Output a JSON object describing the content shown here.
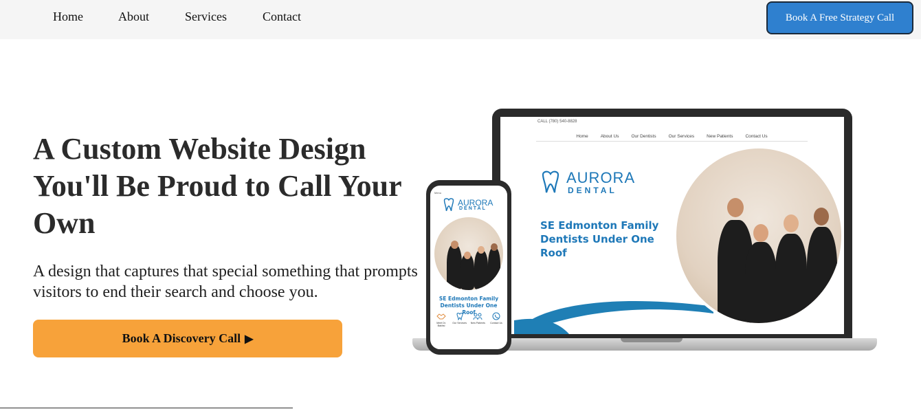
{
  "nav": {
    "links": [
      "Home",
      "About",
      "Services",
      "Contact"
    ],
    "cta_label": "Book A Free Strategy Call"
  },
  "hero": {
    "title": "A Custom Website Design You'll Be Proud to Call Your Own",
    "subtitle": "A design that captures that special something that prompts visitors to end their search and choose you.",
    "cta_label": "Book A Discovery Call",
    "cta_icon": "play-arrow-icon"
  },
  "laptop_mockup": {
    "topbar": "CALL (780) 540-8828",
    "menu": [
      "Home",
      "About Us",
      "Our Dentists",
      "Our Services",
      "New Patients",
      "Contact Us"
    ],
    "logo_line1": "AURORA",
    "logo_line2": "DENTAL",
    "headline": "SE Edmonton Family Dentists Under One Roof"
  },
  "phone_mockup": {
    "menu": "Menu",
    "logo_line1": "AURORA",
    "logo_line2": "DENTAL",
    "headline": "SE Edmonton Family Dentists Under One Roof",
    "icons": [
      {
        "label": "Meet Dr. Bakhsi",
        "icon": "handshake-icon"
      },
      {
        "label": "Our Services",
        "icon": "tooth-sparkle-icon"
      },
      {
        "label": "New Patients",
        "icon": "people-icon"
      },
      {
        "label": "Contact Us",
        "icon": "phone-icon"
      }
    ]
  },
  "colors": {
    "nav_bg": "#f5f5f5",
    "cta_top_bg": "#2f80cf",
    "cta_main_bg": "#f7a23a",
    "brand_blue": "#1e78b8"
  }
}
